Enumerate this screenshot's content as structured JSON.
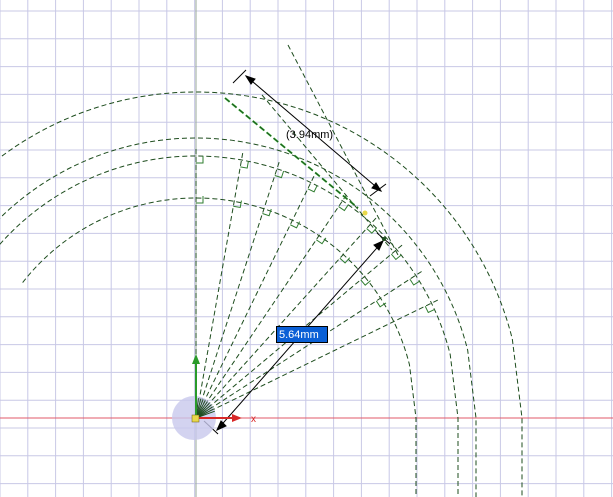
{
  "sketch": {
    "dimension_reference_label": "(3.94mm)",
    "dimension_active_value": "5.64mm",
    "x_axis_label": "x"
  },
  "colors": {
    "background": "#ffffff",
    "grid_line": "#c8c8e6",
    "x_axis": "#e05a6a",
    "y_axis": "#9aaa9a",
    "construction_line": "#1e4d1e",
    "highlight_line": "#3fbf3f",
    "dimension_line": "#000000",
    "input_highlight": "#0a5fd6",
    "origin_disc": "#c8c8ec"
  },
  "icons": [
    "origin-marker-icon",
    "x-axis-arrow-icon",
    "y-axis-arrow-icon",
    "perpendicular-constraint-icon"
  ]
}
